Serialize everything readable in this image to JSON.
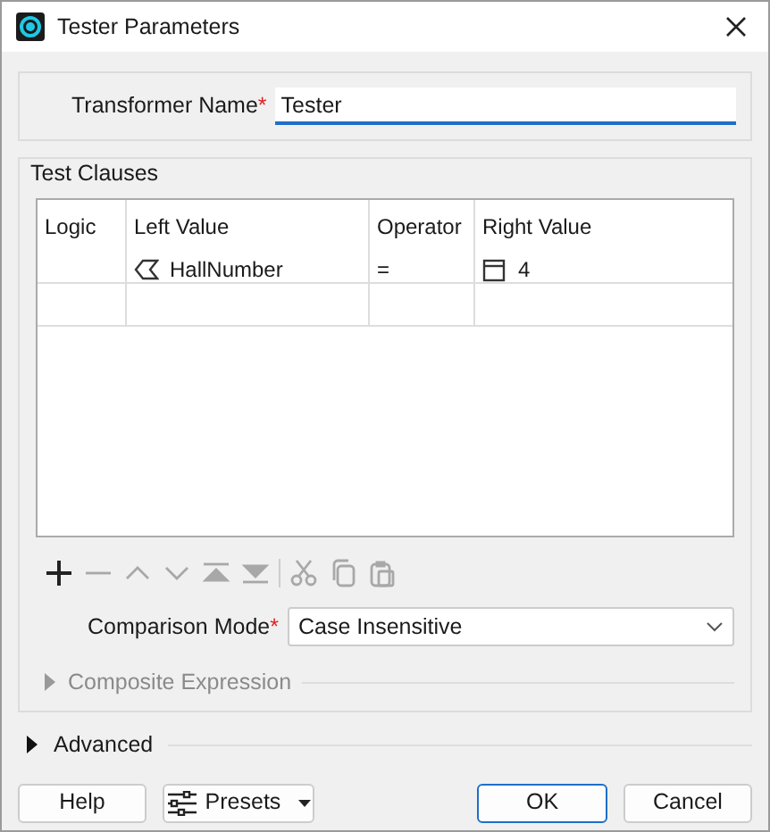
{
  "window": {
    "title": "Tester Parameters"
  },
  "transformer_name": {
    "label": "Transformer Name",
    "required_mark": "*",
    "value": "Tester"
  },
  "test_clauses": {
    "title": "Test Clauses",
    "columns": [
      "Logic",
      "Left Value",
      "Operator",
      "Right Value"
    ],
    "rows": [
      {
        "left_value": {
          "kind": "attribute",
          "text": "HallNumber"
        },
        "operator": "=",
        "right_value": {
          "kind": "constant",
          "text": "4"
        }
      }
    ],
    "toolbar": [
      {
        "kind": "add",
        "disabled": false
      },
      {
        "kind": "remove",
        "disabled": true
      },
      {
        "kind": "up",
        "disabled": true
      },
      {
        "kind": "down",
        "disabled": true
      },
      {
        "kind": "top",
        "disabled": true
      },
      {
        "kind": "bottom",
        "disabled": true
      },
      {
        "kind": "cut",
        "disabled": true
      },
      {
        "kind": "copy",
        "disabled": true
      },
      {
        "kind": "paste",
        "disabled": true
      }
    ],
    "comparison_mode": {
      "label": "Comparison Mode",
      "required_mark": "*",
      "value": "Case Insensitive"
    },
    "composite_expression": {
      "label": "Composite Expression",
      "expanded": false,
      "disabled": true
    }
  },
  "advanced": {
    "label": "Advanced",
    "expanded": false
  },
  "buttons": [
    {
      "label": "Help",
      "kind": "plain"
    },
    {
      "label": "Presets",
      "kind": "presets"
    },
    {
      "label": "OK",
      "kind": "default"
    },
    {
      "label": "Cancel",
      "kind": "plain"
    }
  ]
}
